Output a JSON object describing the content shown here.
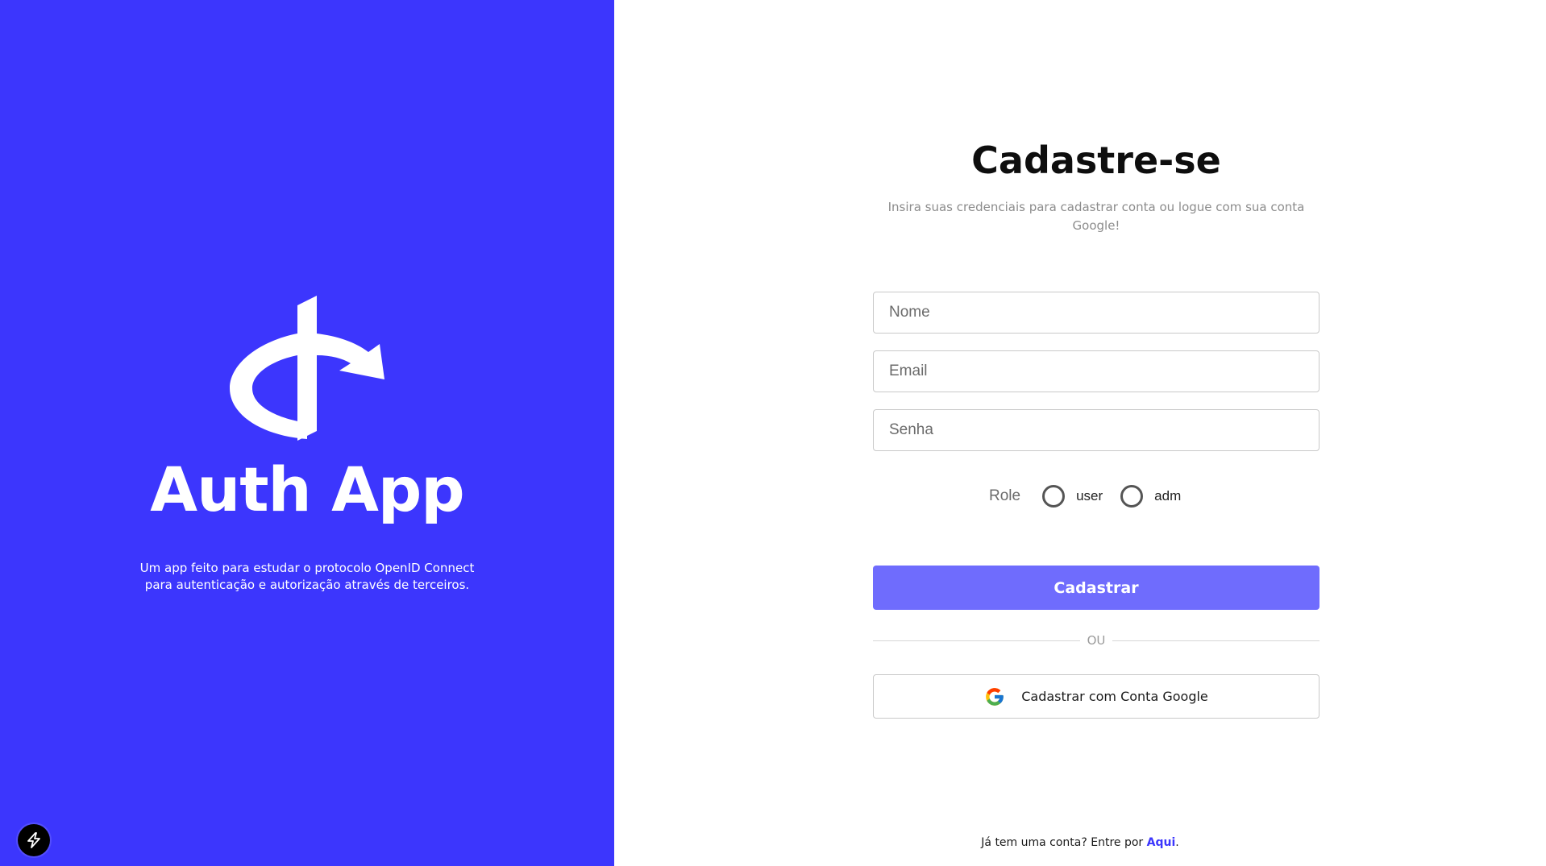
{
  "brand": {
    "logo_icon": "openid-logo-icon",
    "title": "Auth App",
    "description": "Um app feito para estudar o protocolo OpenID Connect para autenticação e autorização através de terceiros.",
    "badge_icon": "lightning-icon",
    "background_color": "#3c36fd"
  },
  "form": {
    "title": "Cadastre-se",
    "subtitle": "Insira suas credenciais para cadastrar conta ou logue com sua conta Google!",
    "fields": {
      "name_placeholder": "Nome",
      "email_placeholder": "Email",
      "password_placeholder": "Senha"
    },
    "role": {
      "label": "Role",
      "options": [
        "user",
        "adm"
      ]
    },
    "submit_label": "Cadastrar",
    "submit_color": "#6f6cfd",
    "divider_text": "OU",
    "google_label": "Cadastrar com Conta Google",
    "google_icon": "google-icon"
  },
  "footer": {
    "prompt": "Já tem uma conta? Entre por ",
    "link": "Aqui",
    "suffix": "."
  }
}
